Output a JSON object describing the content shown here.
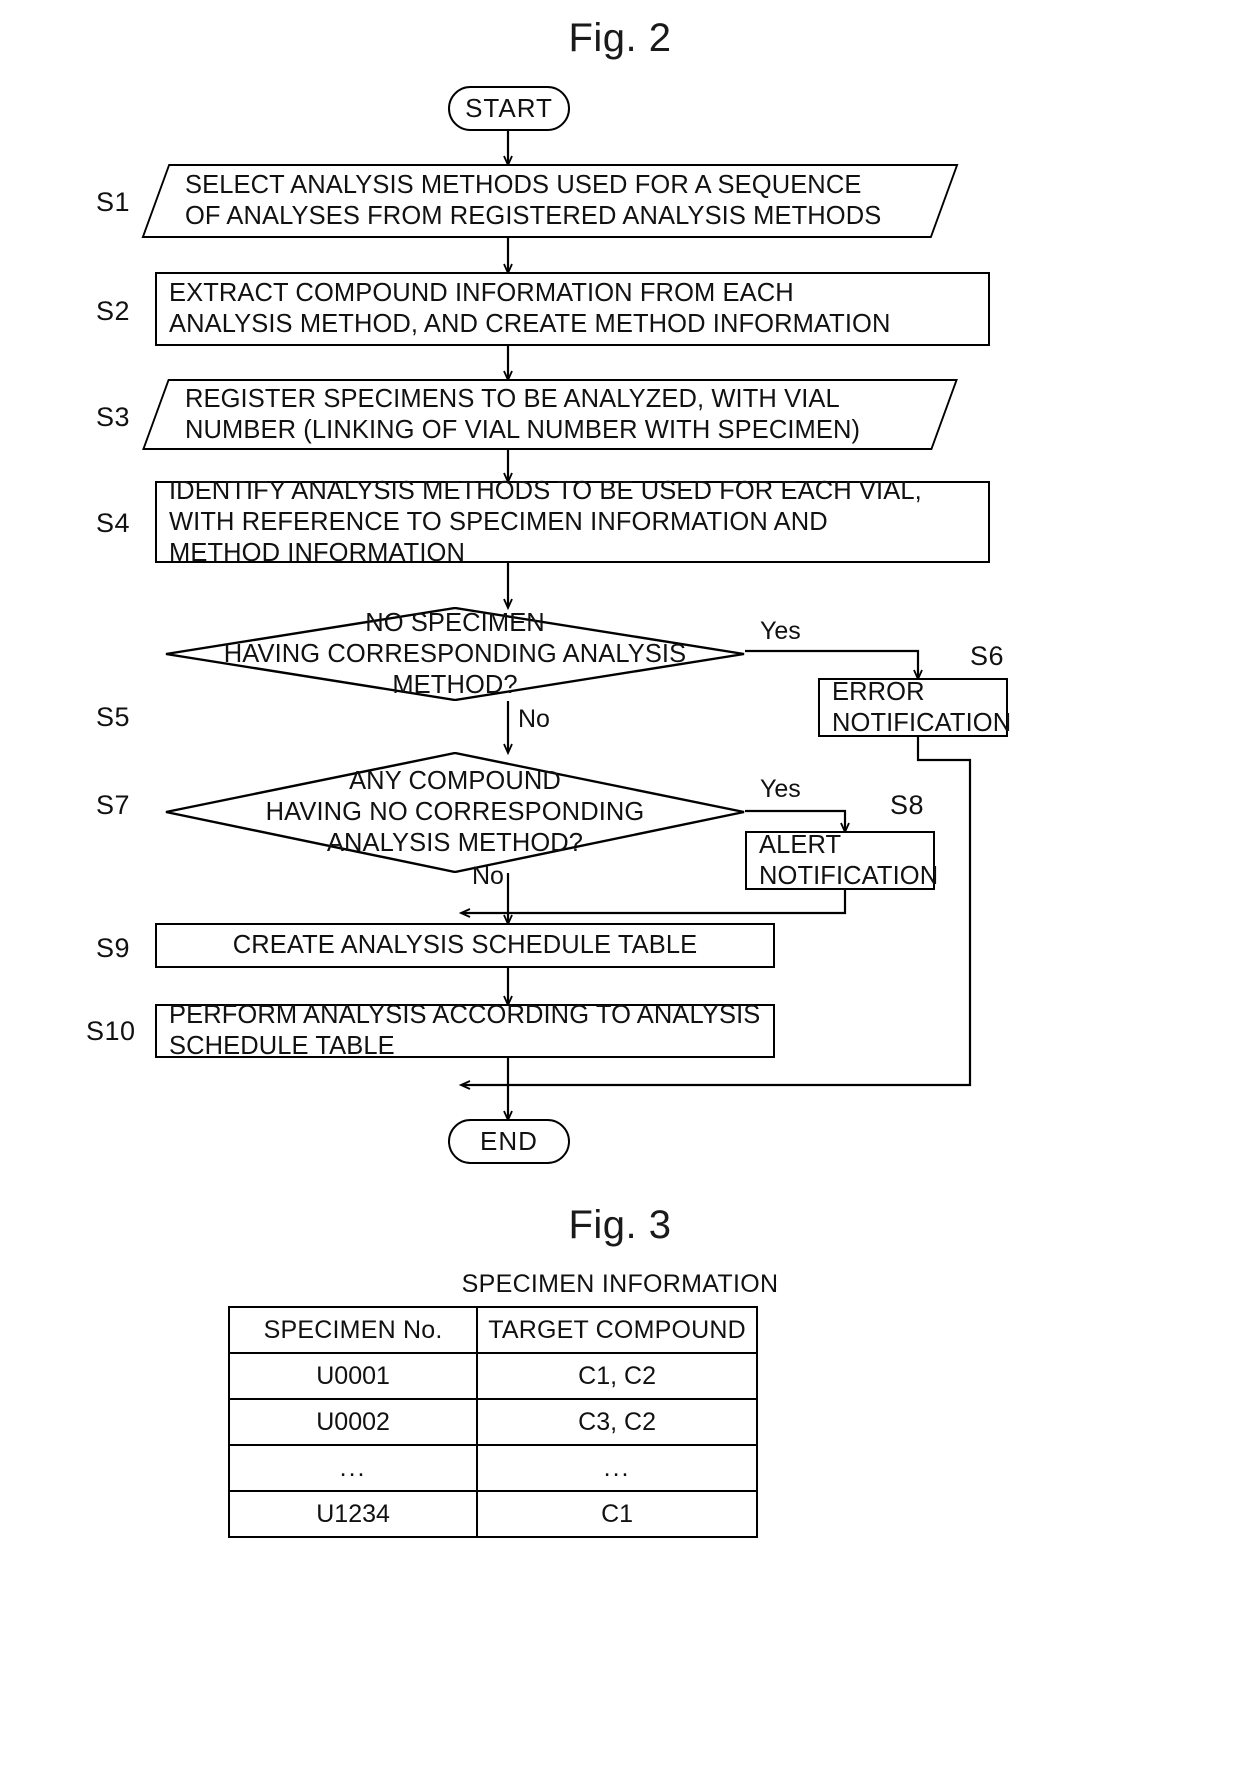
{
  "fig2": {
    "title": "Fig. 2",
    "start_label": "START",
    "end_label": "END",
    "steps": [
      {
        "id": "S1",
        "ref": "S1",
        "shape": "io",
        "text": "SELECT ANALYSIS METHODS USED FOR A SEQUENCE\nOF ANALYSES FROM REGISTERED ANALYSIS METHODS"
      },
      {
        "id": "S2",
        "ref": "S2",
        "shape": "process",
        "text": "EXTRACT COMPOUND INFORMATION FROM EACH\nANALYSIS METHOD, AND CREATE METHOD INFORMATION"
      },
      {
        "id": "S3",
        "ref": "S3",
        "shape": "io",
        "text": "REGISTER SPECIMENS TO BE ANALYZED, WITH VIAL\nNUMBER (LINKING OF VIAL NUMBER WITH SPECIMEN)"
      },
      {
        "id": "S4",
        "ref": "S4",
        "shape": "process",
        "text": "IDENTIFY ANALYSIS METHODS TO BE USED FOR EACH VIAL,\nWITH REFERENCE TO SPECIMEN INFORMATION AND\nMETHOD INFORMATION"
      },
      {
        "id": "S5",
        "ref": "S5",
        "shape": "decision",
        "text": "NO SPECIMEN\nHAVING CORRESPONDING ANALYSIS\nMETHOD?"
      },
      {
        "id": "S6",
        "ref": "S6",
        "shape": "process",
        "text": "ERROR\nNOTIFICATION"
      },
      {
        "id": "S7",
        "ref": "S7",
        "shape": "decision",
        "text": "ANY COMPOUND\nHAVING NO CORRESPONDING\nANALYSIS METHOD?"
      },
      {
        "id": "S8",
        "ref": "S8",
        "shape": "process",
        "text": "ALERT\nNOTIFICATION"
      },
      {
        "id": "S9",
        "ref": "S9",
        "shape": "process",
        "text": "CREATE ANALYSIS SCHEDULE TABLE"
      },
      {
        "id": "S10",
        "ref": "S10",
        "shape": "process",
        "text": "PERFORM ANALYSIS ACCORDING TO ANALYSIS\nSCHEDULE TABLE"
      }
    ],
    "branches": {
      "s5_yes": "Yes",
      "s5_no": "No",
      "s7_yes": "Yes",
      "s7_no": "No"
    }
  },
  "fig3": {
    "title": "Fig. 3",
    "caption": "SPECIMEN INFORMATION",
    "table": {
      "headers": [
        "SPECIMEN No.",
        "TARGET COMPOUND"
      ],
      "rows": [
        [
          "U0001",
          "C1, C2"
        ],
        [
          "U0002",
          "C3, C2"
        ],
        [
          "...",
          "..."
        ],
        [
          "U1234",
          "C1"
        ]
      ]
    }
  }
}
